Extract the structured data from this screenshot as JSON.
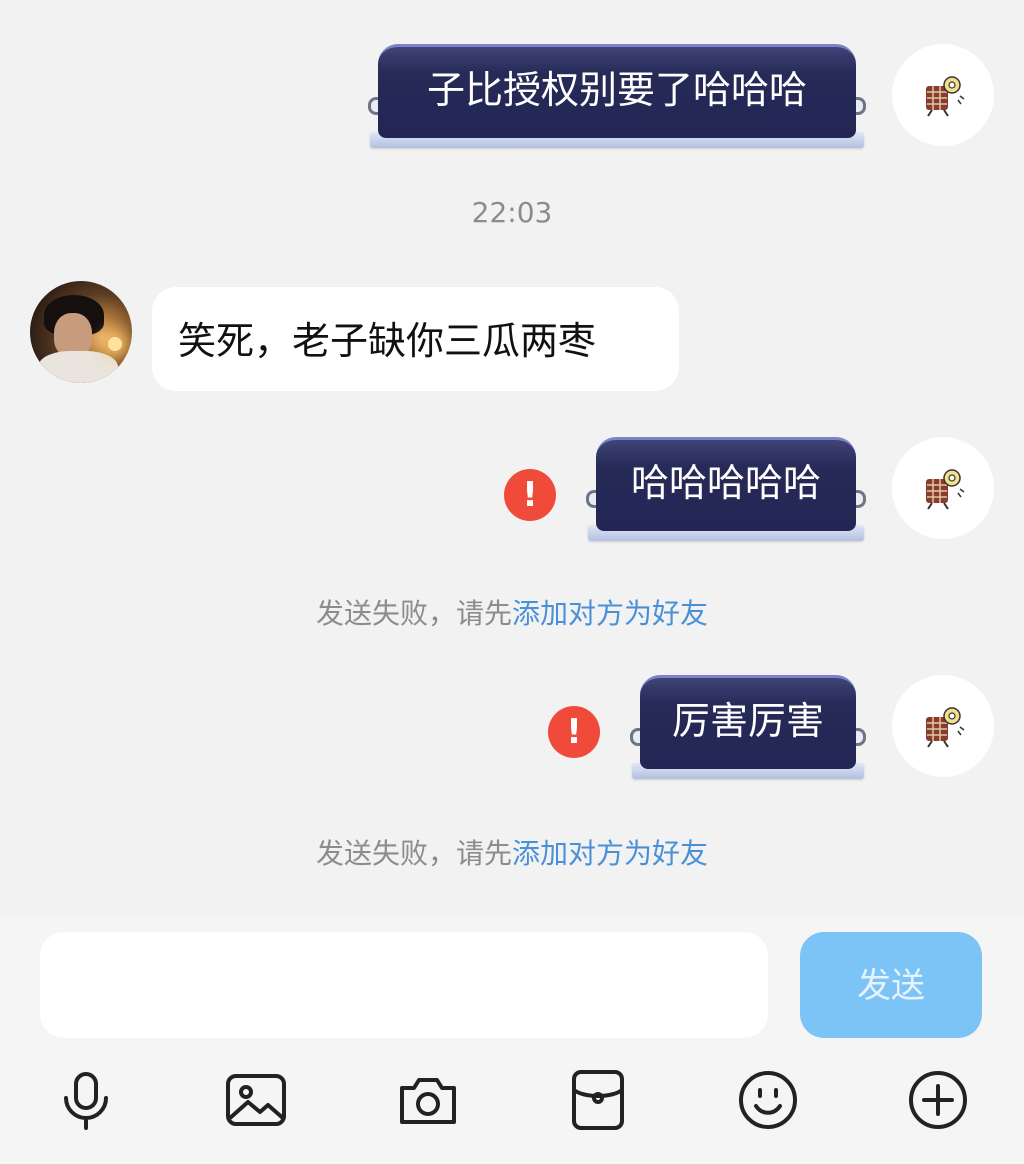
{
  "messages": [
    {
      "side": "out",
      "text": "子比授权别要了哈哈哈",
      "failed": false
    },
    {
      "type": "time",
      "text": "22:03"
    },
    {
      "side": "in",
      "text": "笑死，老子缺你三瓜两枣"
    },
    {
      "side": "out",
      "text": "哈哈哈哈哈",
      "failed": true
    },
    {
      "type": "notice",
      "text": "发送失败，请先",
      "link": "添加对方为好友"
    },
    {
      "side": "out",
      "text": "厉害厉害",
      "failed": true
    },
    {
      "type": "notice",
      "text": "发送失败，请先",
      "link": "添加对方为好友"
    }
  ],
  "error_glyph": "!",
  "composer": {
    "input_value": "",
    "send_label": "发送",
    "tools": [
      "microphone-icon",
      "image-icon",
      "camera-icon",
      "red-packet-icon",
      "emoji-icon",
      "plus-icon"
    ]
  },
  "colors": {
    "background": "#f2f2f2",
    "tag_bubble": "#262a57",
    "error": "#f04b3a",
    "link": "#4a90d9",
    "send_button": "#7cc3f6"
  }
}
